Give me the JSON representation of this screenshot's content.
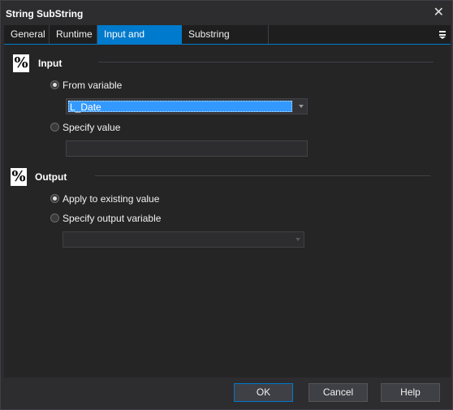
{
  "window": {
    "title": "String SubString"
  },
  "tabs": [
    {
      "label": "General"
    },
    {
      "label": "Runtime"
    },
    {
      "label": "Input and Output"
    },
    {
      "label": "Substring Options"
    }
  ],
  "input_section": {
    "title": "Input",
    "from_variable_label": "From variable",
    "from_variable_value": "L_Date",
    "specify_value_label": "Specify value",
    "specify_value_value": ""
  },
  "output_section": {
    "title": "Output",
    "apply_existing_label": "Apply to existing value",
    "specify_output_label": "Specify output variable",
    "output_variable_value": ""
  },
  "buttons": {
    "ok": "OK",
    "cancel": "Cancel",
    "help": "Help"
  },
  "icons": {
    "section": "%"
  },
  "colors": {
    "accent": "#007acc",
    "selection": "#3399ff"
  }
}
